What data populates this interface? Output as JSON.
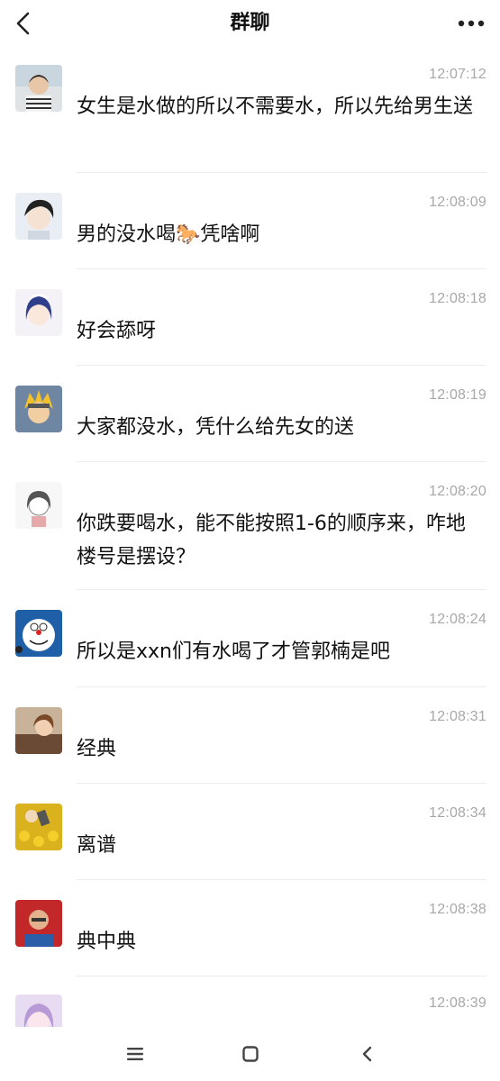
{
  "header": {
    "title": "群聊",
    "back_icon": "chevron-left-icon",
    "more_icon": "more-dots-icon"
  },
  "messages": [
    {
      "time": "12:07:12",
      "text": "女生是水做的所以不需要水，所以先给男生送",
      "avatar": "avatar-boy-photo"
    },
    {
      "time": "12:08:09",
      "text": "男的没水喝🐎凭啥啊",
      "avatar": "avatar-anime-boy"
    },
    {
      "time": "12:08:18",
      "text": "好会舔呀",
      "avatar": "avatar-anime-girl-blue"
    },
    {
      "time": "12:08:19",
      "text": "大家都没水，凭什么给先女的送",
      "avatar": "avatar-naruto"
    },
    {
      "time": "12:08:20",
      "text": "你跌要喝水，能不能按照1-6的顺序来，咋地楼号是摆设？",
      "avatar": "avatar-sketch-girl"
    },
    {
      "time": "12:08:24",
      "text": "所以是xxn们有水喝了才管郭楠是吧",
      "avatar": "avatar-doraemon"
    },
    {
      "time": "12:08:31",
      "text": "经典",
      "avatar": "avatar-anime-couple"
    },
    {
      "time": "12:08:34",
      "text": "离谱",
      "avatar": "avatar-sunflower-field"
    },
    {
      "time": "12:08:38",
      "text": "典中典",
      "avatar": "avatar-man-red"
    },
    {
      "time": "12:08:39",
      "text": "",
      "avatar": "avatar-anime-purple"
    }
  ],
  "navbar": {
    "menu_icon": "menu-icon",
    "home_icon": "home-square-icon",
    "back_icon": "nav-back-icon"
  }
}
